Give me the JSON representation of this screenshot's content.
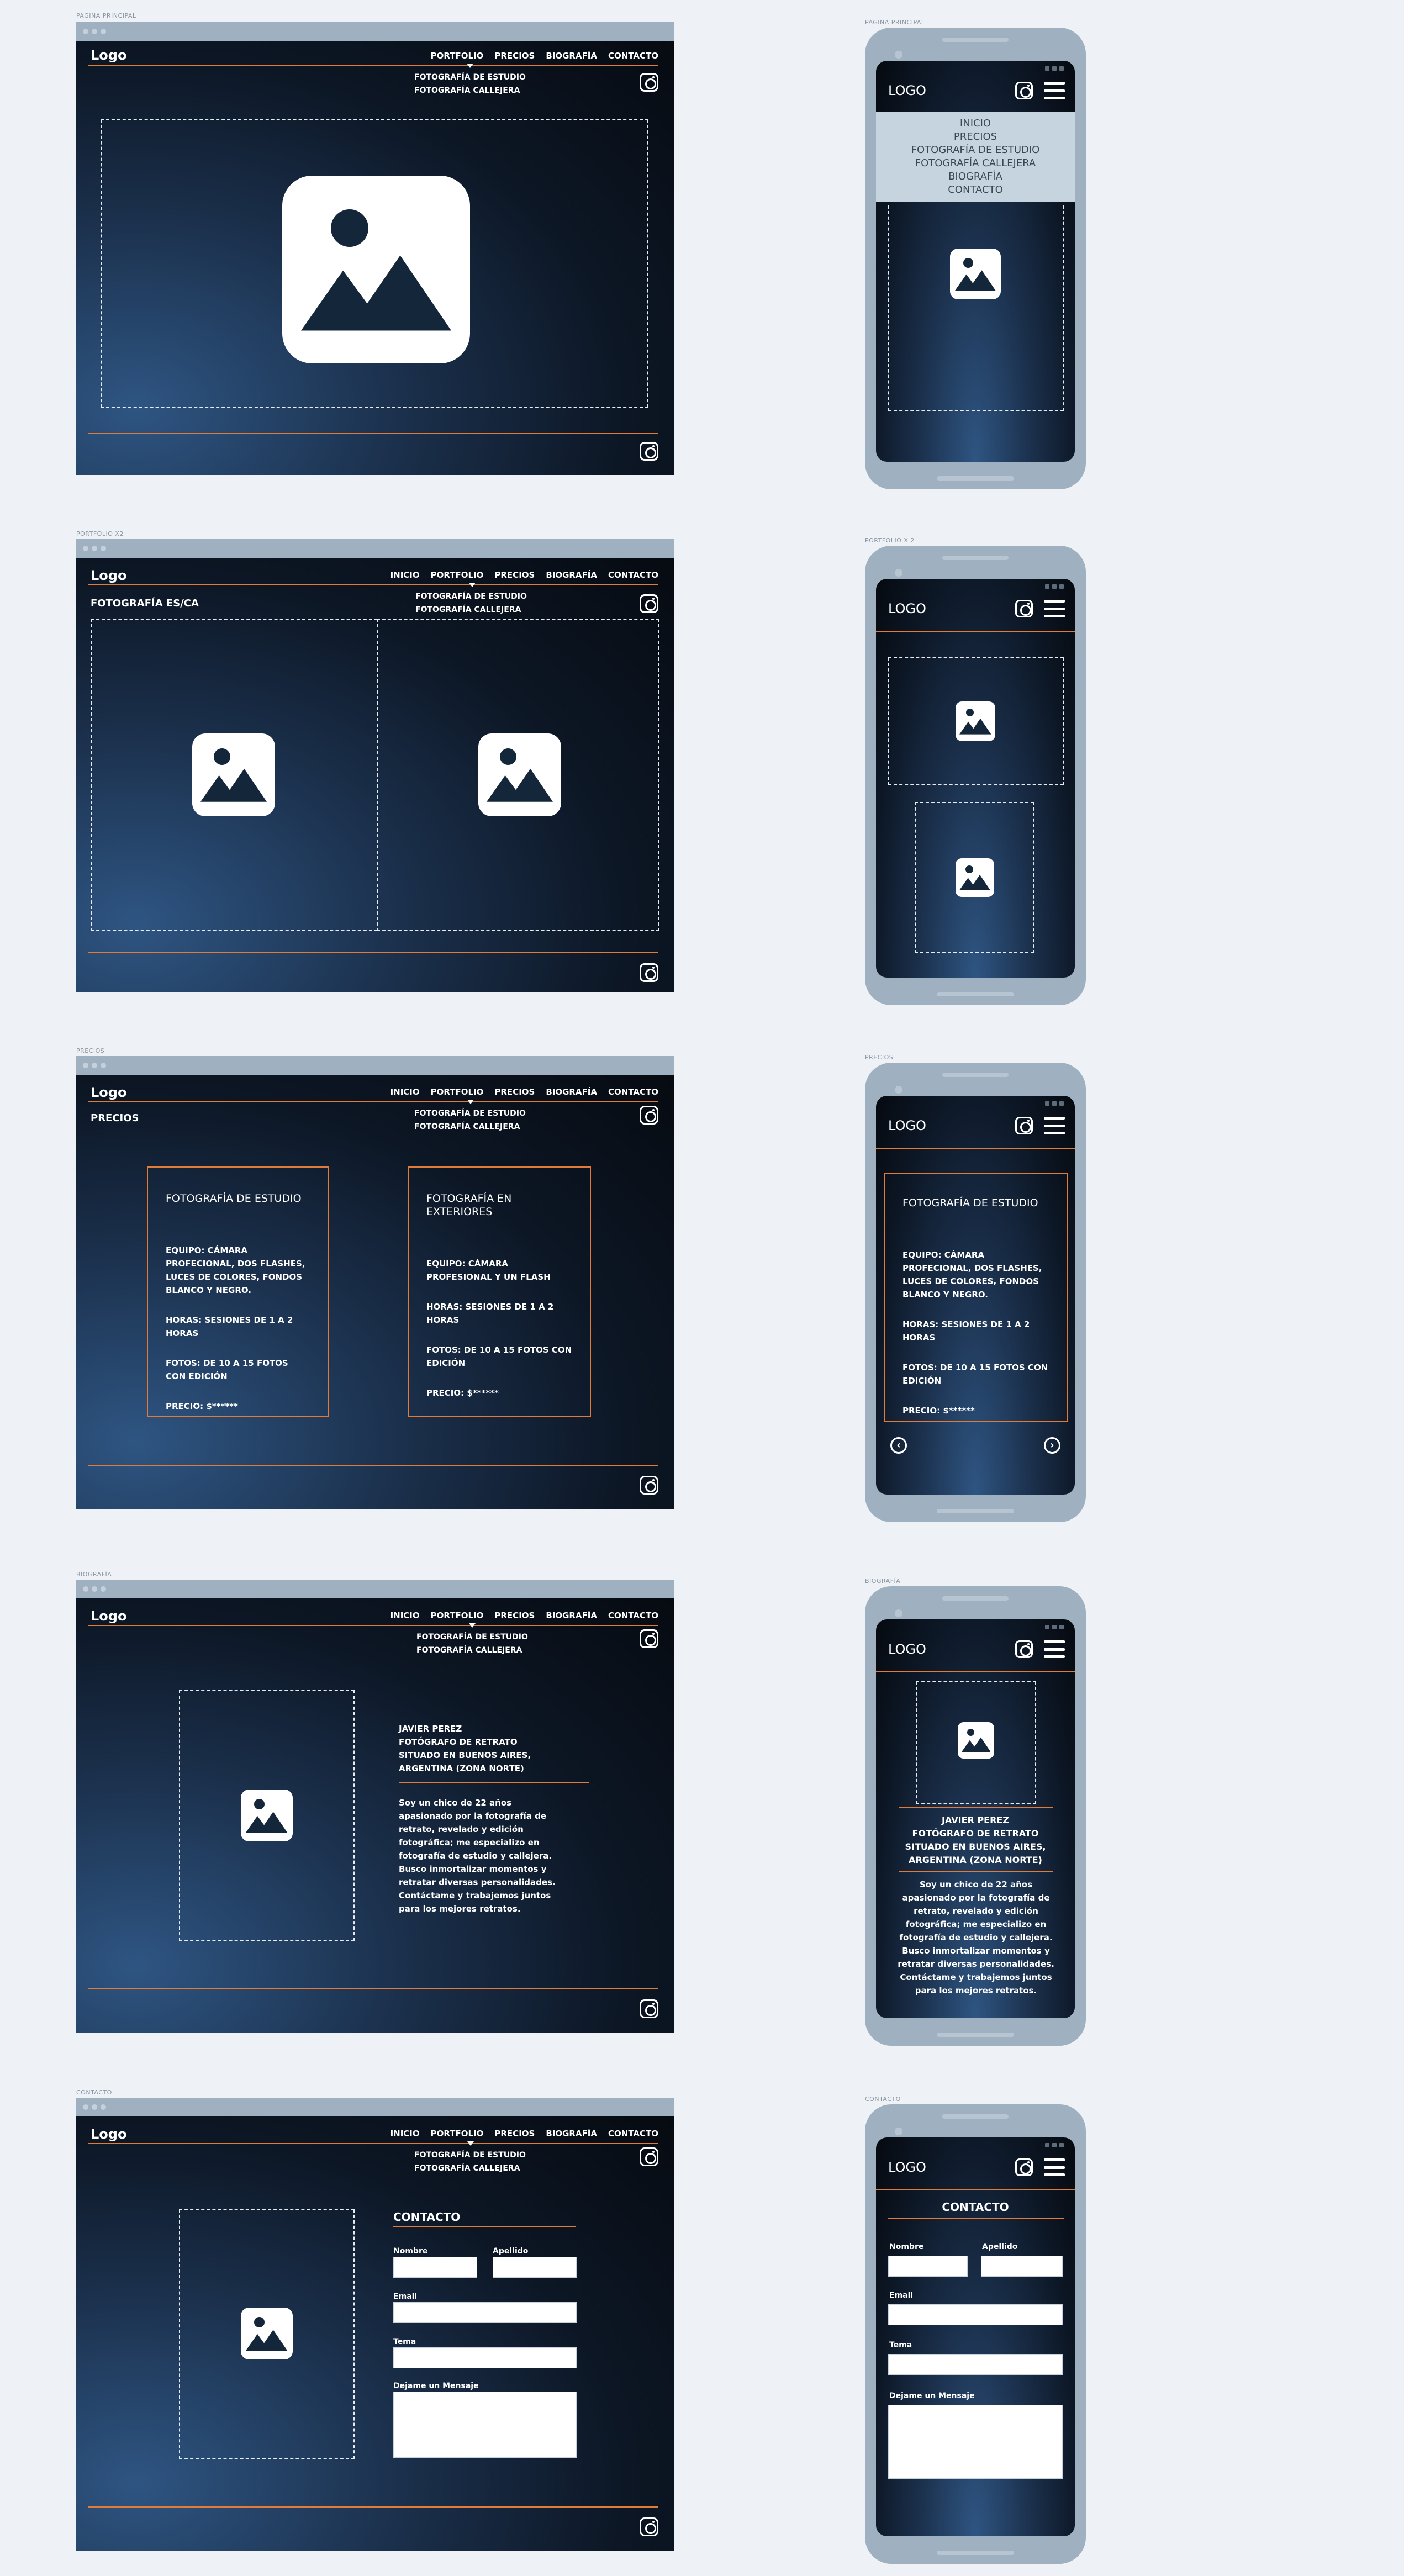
{
  "captions": {
    "home": "PÁGINA PRINCIPAL",
    "portfolio": "PORTFOLIO X2",
    "prices": "PRECIOS",
    "bio": "BIOGRAFÍA",
    "contact": "CONTACTO",
    "m_home": "PÁGINA PRINCIPAL",
    "m_portfolio": "PORTFOLIO X 2",
    "m_prices": "PRECIOS",
    "m_bio": "BIOGRAFÍA",
    "m_contact": "CONTACTO"
  },
  "brand": {
    "logo": "Logo",
    "logo_mobile": "LOGO"
  },
  "nav": {
    "inicio": "INICIO",
    "portfolio": "PORTFOLIO",
    "precios": "PRECIOS",
    "biografia": "BIOGRAFÍA",
    "contacto": "CONTACTO"
  },
  "submenu": {
    "estudio": "FOTOGRAFÍA DE ESTUDIO",
    "callejera": "FOTOGRAFÍA CALLEJERA"
  },
  "mobile_menu": [
    "INICIO",
    "PRECIOS",
    "FOTOGRAFÍA DE ESTUDIO",
    "FOTOGRAFÍA CALLEJERA",
    "BIOGRAFÍA",
    "CONTACTO"
  ],
  "portfolio": {
    "title": "FOTOGRAFÍA ES/CA"
  },
  "prices": {
    "title": "PRECIOS",
    "card1": {
      "title": "FOTOGRAFÍA DE ESTUDIO",
      "equipo": "EQUIPO: CÁMARA PROFECIONAL, DOS FLASHES, LUCES DE COLORES, FONDOS BLANCO Y NEGRO.",
      "horas": "HORAS: SESIONES DE 1 A 2 HORAS",
      "fotos": "FOTOS: DE 10 A 15 FOTOS CON EDICIÓN",
      "precio": "PRECIO: $******"
    },
    "card2": {
      "title": "FOTOGRAFÍA EN EXTERIORES",
      "equipo": "EQUIPO: CÁMARA PROFESIONAL Y UN FLASH",
      "horas": "HORAS: SESIONES DE 1 A 2 HORAS",
      "fotos": "FOTOS: DE 10 A 15 FOTOS CON EDICIÓN",
      "precio": "PRECIO: $******"
    },
    "prev_arrow": "‹",
    "next_arrow": "›"
  },
  "bio": {
    "name": "JAVIER PEREZ",
    "role": "FOTÓGRAFO DE RETRATO",
    "location1": "SITUADO EN BUENOS AIRES,",
    "location2": "ARGENTINA (ZONA NORTE)",
    "body": "Soy un chico de 22 años apasionado por la fotografía de retrato, revelado y edición fotográfica; me especializo en fotografía de estudio y callejera. Busco inmortalizar momentos y retratar diversas personalidades. Contáctame y trabajemos juntos para los mejores retratos."
  },
  "contact": {
    "title": "CONTACTO",
    "nombre": "Nombre",
    "apellido": "Apellido",
    "email": "Email",
    "tema": "Tema",
    "mensaje": "Dejame un Mensaje"
  }
}
